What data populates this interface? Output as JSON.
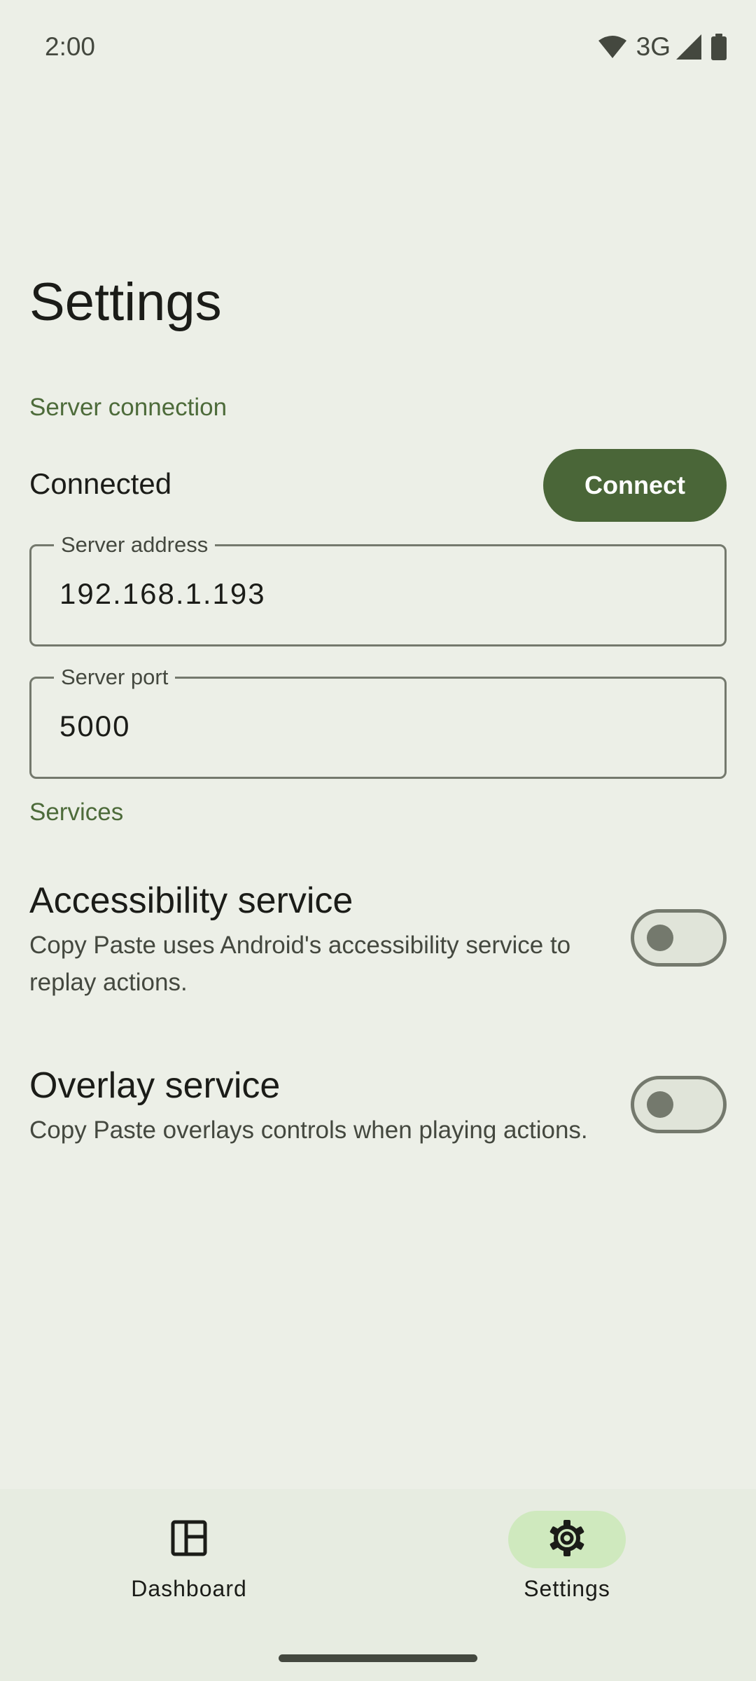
{
  "status_bar": {
    "time": "2:00",
    "network_type": "3G",
    "icons": [
      "wifi-icon",
      "cell-signal-icon",
      "battery-icon"
    ]
  },
  "page": {
    "title": "Settings"
  },
  "server_connection": {
    "header": "Server connection",
    "status": "Connected",
    "connect_label": "Connect",
    "address": {
      "label": "Server address",
      "value": "192.168.1.193"
    },
    "port": {
      "label": "Server port",
      "value": "5000"
    }
  },
  "services": {
    "header": "Services",
    "items": [
      {
        "title": "Accessibility service",
        "description": "Copy Paste uses Android's accessibility service to replay actions.",
        "enabled": false
      },
      {
        "title": "Overlay service",
        "description": "Copy Paste overlays controls when playing actions.",
        "enabled": false
      }
    ]
  },
  "bottom_nav": {
    "items": [
      {
        "label": "Dashboard",
        "icon": "dashboard-icon",
        "active": false
      },
      {
        "label": "Settings",
        "icon": "gear-icon",
        "active": true
      }
    ]
  },
  "colors": {
    "background": "#ecefe7",
    "accent": "#4a6638",
    "section_header": "#4d6b3a",
    "active_nav_pill": "#cfe9be"
  }
}
